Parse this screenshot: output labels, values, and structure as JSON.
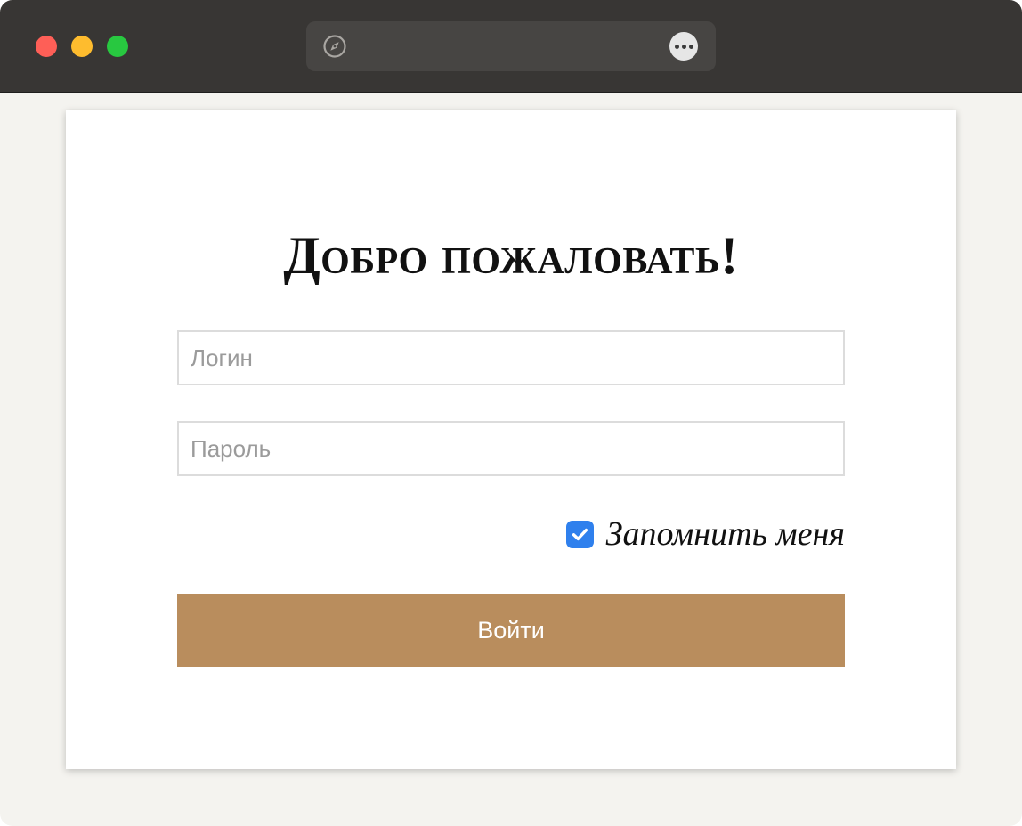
{
  "window": {
    "controls": {
      "close_color": "#fe5f57",
      "minimize_color": "#febc2e",
      "maximize_color": "#28c840"
    },
    "address_bar": {
      "url": "",
      "icon": "compass-icon",
      "more_icon": "more-options-icon"
    }
  },
  "login_form": {
    "title": "Добро пожаловать!",
    "login_field": {
      "value": "",
      "placeholder": "Логин"
    },
    "password_field": {
      "value": "",
      "placeholder": "Пароль"
    },
    "remember_me": {
      "label": "Запомнить меня",
      "checked": true
    },
    "submit_label": "Войти"
  },
  "colors": {
    "titlebar": "#383634",
    "page_background": "#f4f3ef",
    "accent": "#b98d5d",
    "checkbox": "#2f80ed"
  }
}
